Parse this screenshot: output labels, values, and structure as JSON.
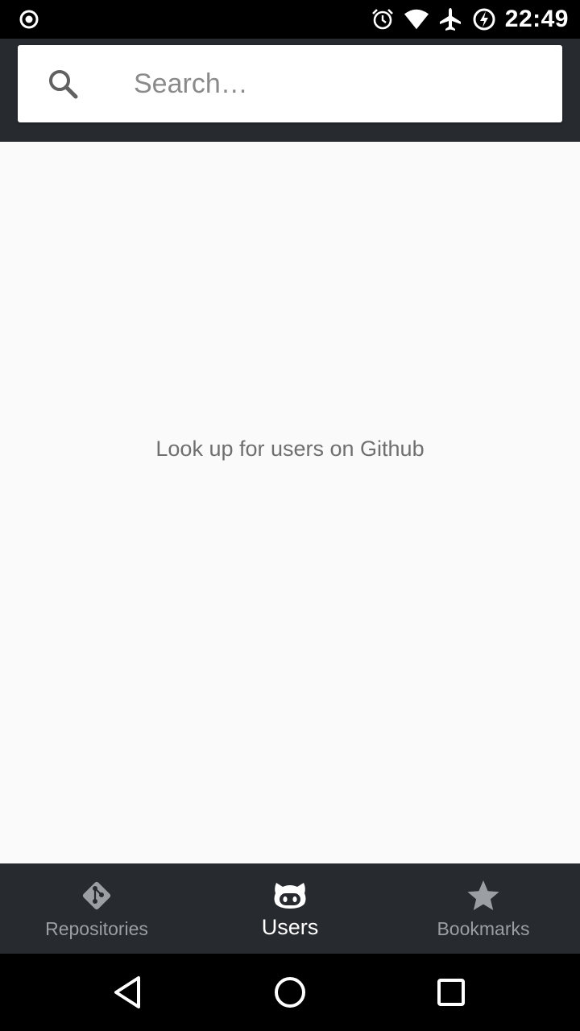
{
  "status_bar": {
    "time": "22:49",
    "icons": [
      "record-icon",
      "alarm-icon",
      "wifi-icon",
      "airplane-mode-icon",
      "battery-charging-icon"
    ]
  },
  "search": {
    "placeholder": "Search…",
    "value": ""
  },
  "content": {
    "empty_message": "Look up for users on Github"
  },
  "bottom_nav": {
    "items": [
      {
        "label": "Repositories",
        "icon": "git-icon",
        "active": false
      },
      {
        "label": "Users",
        "icon": "octocat-icon",
        "active": true
      },
      {
        "label": "Bookmarks",
        "icon": "star-icon",
        "active": false
      }
    ]
  },
  "system_nav": {
    "buttons": [
      "back-icon",
      "home-icon",
      "recents-icon"
    ]
  },
  "colors": {
    "toolbar": "#272b30",
    "background": "#fafafa",
    "inactive_nav": "#9b9ea2",
    "active_nav": "#ffffff"
  }
}
